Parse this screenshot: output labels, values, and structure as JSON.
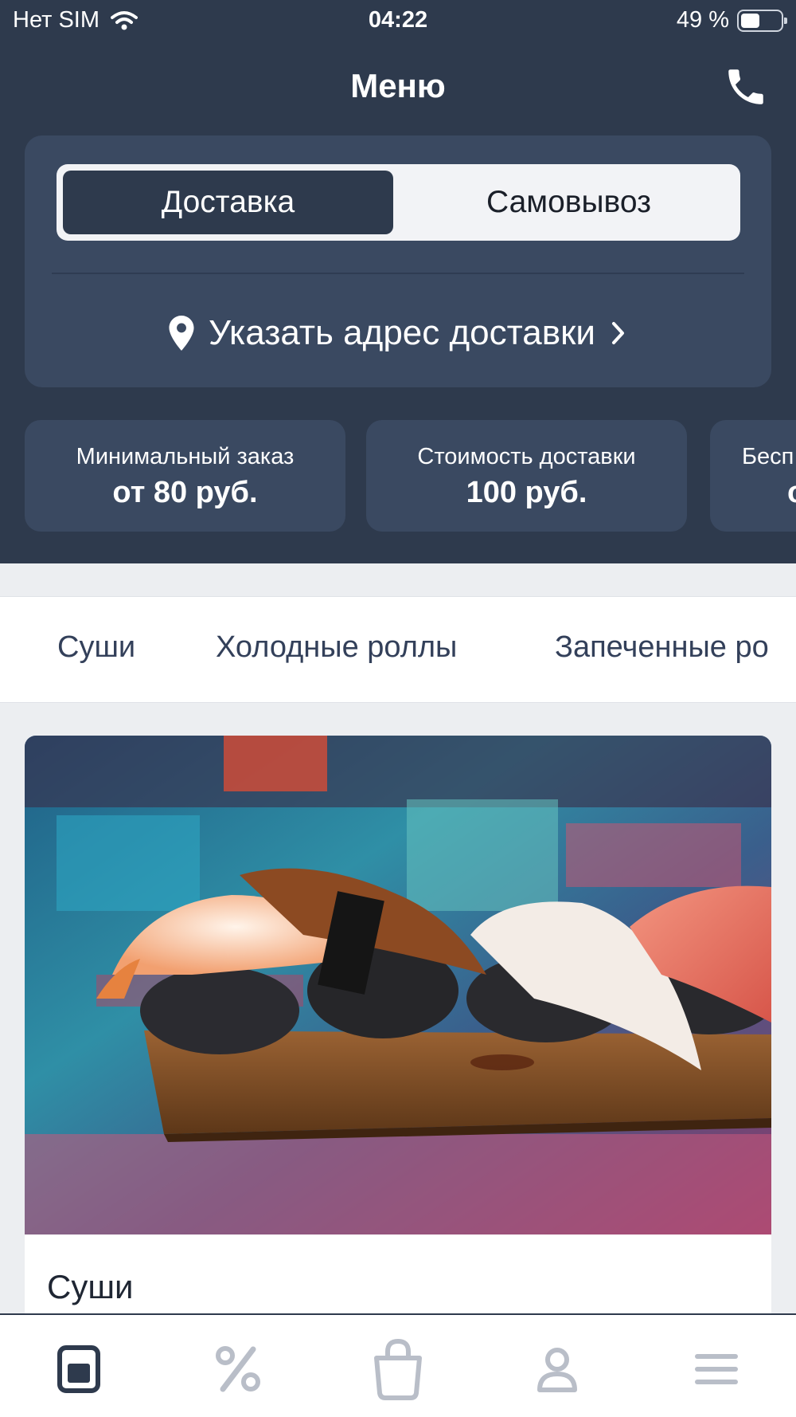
{
  "status_bar": {
    "carrier": "Нет SIM",
    "time": "04:22",
    "battery_text": "49 %",
    "battery_level": 0.49
  },
  "nav": {
    "title": "Меню",
    "phone_icon": "phone-icon"
  },
  "delivery": {
    "segments": [
      "Доставка",
      "Самовывоз"
    ],
    "selected_segment": "Доставка",
    "address_label": "Указать адрес доставки",
    "address_icon": "location-pin-icon",
    "chevron_icon": "chevron-right-icon"
  },
  "info_cards": [
    {
      "label": "Минимальный заказ",
      "value": "от 80 руб."
    },
    {
      "label": "Стоимость доставки",
      "value": "100 руб."
    },
    {
      "label": "Бесп",
      "value": "о"
    }
  ],
  "category_tabs": [
    "Суши",
    "Холодные роллы",
    "Запеченные ро"
  ],
  "category_card": {
    "title": "Суши"
  },
  "bottom_tabs": [
    {
      "icon": "menu-icon",
      "active": true
    },
    {
      "icon": "percent-icon",
      "active": false
    },
    {
      "icon": "shopping-bag-icon",
      "active": false
    },
    {
      "icon": "profile-icon",
      "active": false
    },
    {
      "icon": "hamburger-icon",
      "active": false
    }
  ],
  "colors": {
    "header_bg": "#2e3a4d",
    "card_bg": "#3a4961",
    "active_icon": "#2e3a4d",
    "inactive_icon": "#b9bec8"
  }
}
